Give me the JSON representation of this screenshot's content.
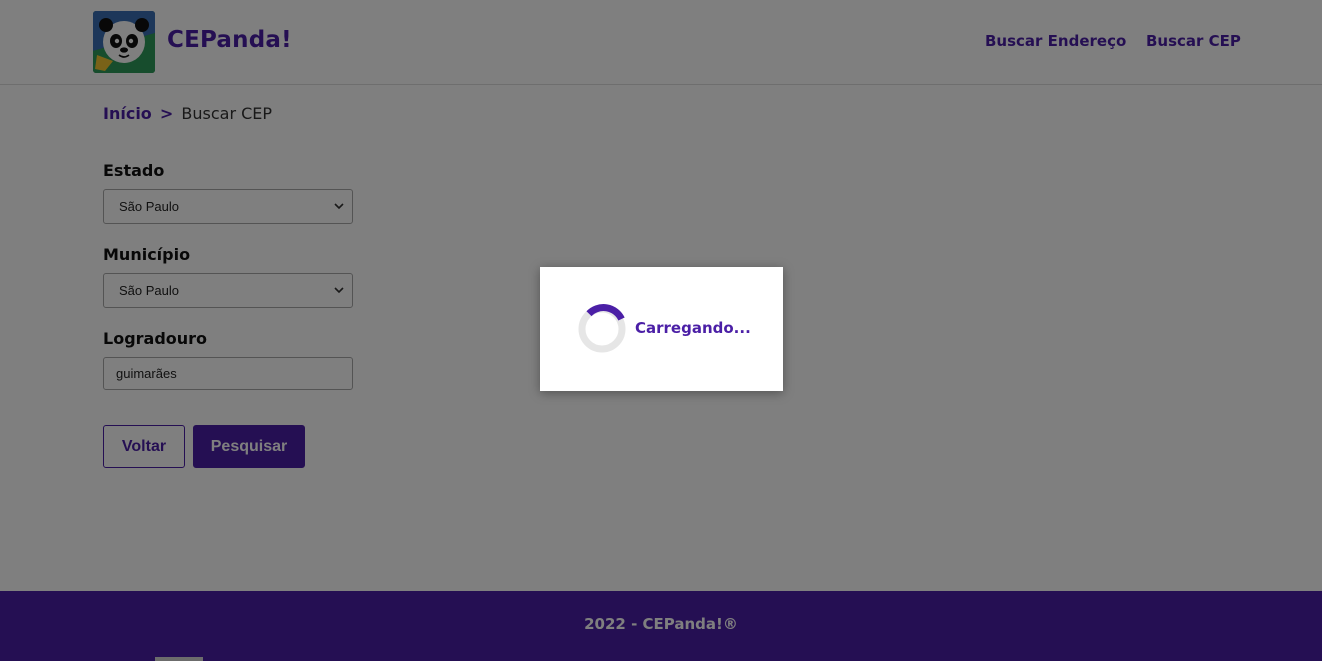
{
  "header": {
    "brand": "CEPanda!",
    "logo_icon": "panda-logo-icon",
    "nav": [
      {
        "label": "Buscar Endereço"
      },
      {
        "label": "Buscar CEP"
      }
    ]
  },
  "breadcrumb": {
    "home": "Início",
    "separator": ">",
    "current": "Buscar CEP"
  },
  "form": {
    "estado": {
      "label": "Estado",
      "value": "São Paulo"
    },
    "municipio": {
      "label": "Município",
      "value": "São Paulo"
    },
    "logradouro": {
      "label": "Logradouro",
      "value": "guimarães"
    },
    "back_label": "Voltar",
    "search_label": "Pesquisar"
  },
  "footer": {
    "text": "2022 - CEPanda!®"
  },
  "loading": {
    "text": "Carregando..."
  },
  "colors": {
    "accent": "#4b1fa6",
    "overlay": "rgba(0,0,0,0.5)"
  }
}
